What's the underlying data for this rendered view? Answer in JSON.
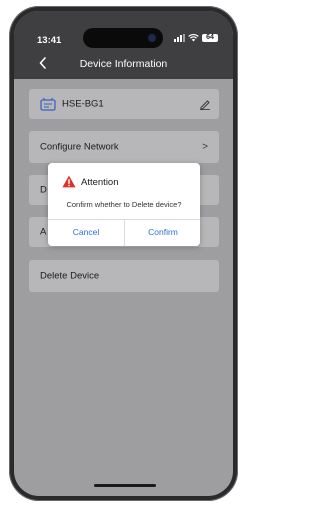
{
  "status_bar": {
    "time": "13:41",
    "battery": "64"
  },
  "header": {
    "title": "Device Information"
  },
  "device": {
    "name": "HSE-BG1"
  },
  "menu": {
    "configure_network": "Configure Network",
    "row3_visible_letter": "D",
    "row4_visible_letter": "A",
    "delete_device": "Delete Device"
  },
  "dialog": {
    "title": "Attention",
    "message": "Confirm whether to Delete device?",
    "cancel_label": "Cancel",
    "confirm_label": "Confirm"
  },
  "colors": {
    "header_bg": "#3f3f42",
    "screen_overlay_bg": "#9e9ea0",
    "card_bg": "#b7b7b9",
    "dialog_button_blue": "#2f6fd6",
    "warning_red": "#d9342b",
    "device_icon_blue": "#3a63c4"
  },
  "icons": {
    "back": "chevron-left-icon",
    "device": "device-icon",
    "edit": "pencil-icon",
    "chevron": "chevron-right-icon",
    "warning": "warning-triangle-icon"
  }
}
